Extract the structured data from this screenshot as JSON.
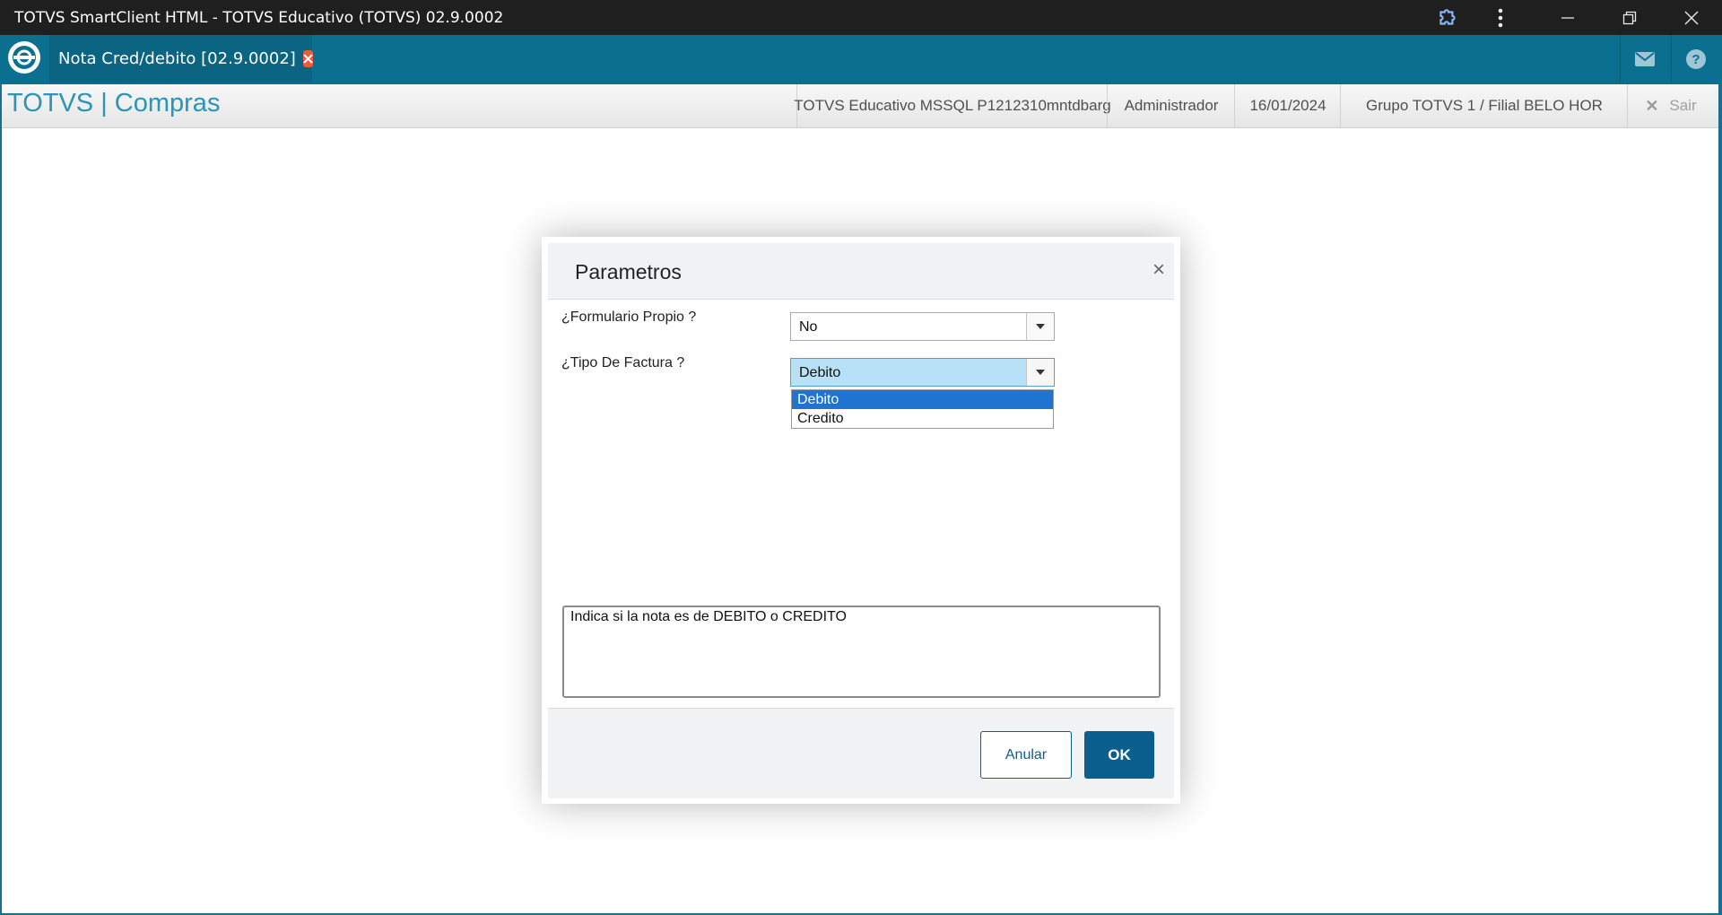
{
  "window": {
    "title": "TOTVS SmartClient HTML - TOTVS Educativo (TOTVS) 02.9.0002"
  },
  "tab": {
    "label": "Nota Cred/debito [02.9.0002]"
  },
  "header": {
    "brand": "TOTVS | Compras",
    "environment": "TOTVS Educativo MSSQL P1212310mntdbarg",
    "user": "Administrador",
    "date": "16/01/2024",
    "branch": "Grupo TOTVS 1 / Filial BELO HOR",
    "exit_label": "Sair"
  },
  "dialog": {
    "title": "Parametros",
    "fields": [
      {
        "label": "¿Formulario Propio ?",
        "value": "No"
      },
      {
        "label": "¿Tipo De Factura ?",
        "value": "Debito"
      }
    ],
    "dropdown_options": [
      "Debito",
      "Credito"
    ],
    "dropdown_selected": "Debito",
    "help_text": "Indica si la nota es de DEBITO o CREDITO",
    "cancel_label": "Anular",
    "ok_label": "OK"
  },
  "colors": {
    "app_bar": "#0b6f8f",
    "brand_text": "#2a95b5",
    "primary_button": "#0b5f8e",
    "selected_option": "#1e74d0",
    "active_combo": "#b8e0f6"
  },
  "icons": [
    "extension-icon",
    "more-vert-icon",
    "minimize-icon",
    "restore-icon",
    "close-icon",
    "totvs-logo-icon",
    "tab-close-icon",
    "mail-icon",
    "help-icon"
  ]
}
